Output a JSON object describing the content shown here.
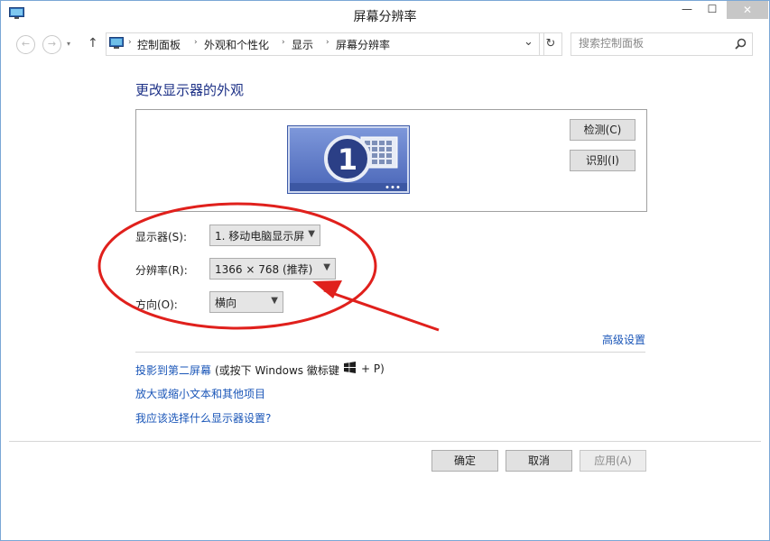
{
  "window": {
    "title": "屏幕分辨率",
    "minimize_glyph": "—",
    "maximize_glyph": "☐",
    "close_glyph": "✕"
  },
  "nav": {
    "back_glyph": "←",
    "forward_glyph": "→",
    "up_glyph": "↑",
    "refresh_glyph": "↻",
    "dropdown_glyph": "⌄",
    "breadcrumbs": [
      "控制面板",
      "外观和个性化",
      "显示",
      "屏幕分辨率"
    ],
    "separator": "›"
  },
  "search": {
    "placeholder": "搜索控制面板",
    "icon": "search-icon"
  },
  "main": {
    "heading": "更改显示器的外观",
    "monitor_number": "1",
    "detect_button": "检测(C)",
    "identify_button": "识别(I)",
    "display_label": "显示器(S):",
    "display_value": "1. 移动电脑显示屏",
    "resolution_label": "分辨率(R):",
    "resolution_value": "1366 × 768 (推荐)",
    "orientation_label": "方向(O):",
    "orientation_value": "横向",
    "advanced_link": "高级设置",
    "project_link": "投影到第二屏幕",
    "project_hint_prefix": "(或按下 Windows 徽标键",
    "project_hint_suffix": "+ P)",
    "text_size_link": "放大或缩小文本和其他项目",
    "which_settings_link": "我应该选择什么显示器设置?"
  },
  "footer": {
    "ok_button": "确定",
    "cancel_button": "取消",
    "apply_button": "应用(A)"
  },
  "colors": {
    "accent_link": "#1a56b8",
    "heading": "#1e3287",
    "annotation_red": "#e0201c",
    "monitor_blue": "#5a78c8"
  }
}
